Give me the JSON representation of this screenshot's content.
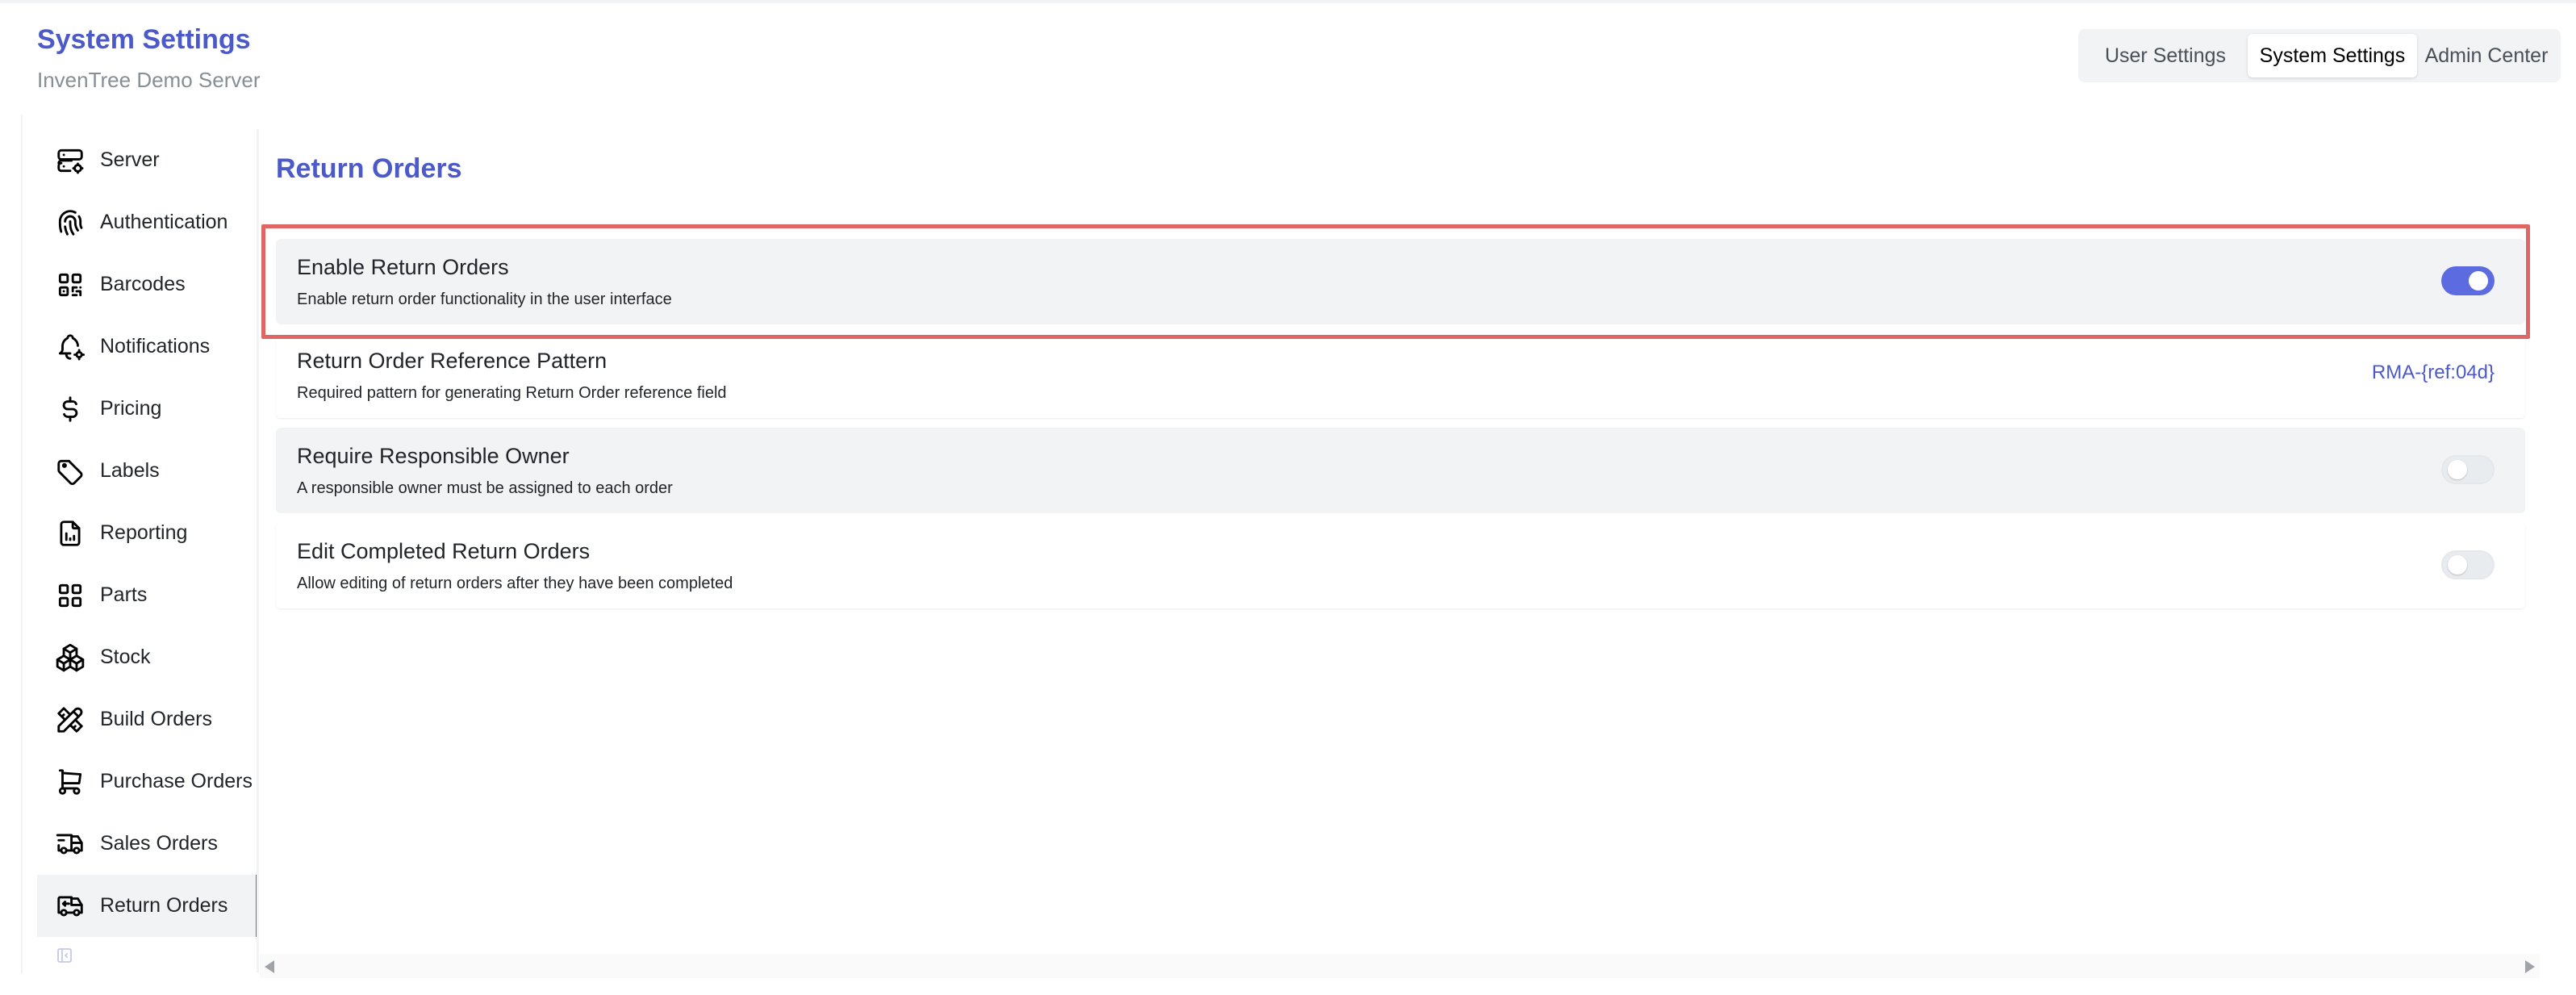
{
  "header": {
    "title": "System Settings",
    "subtitle": "InvenTree Demo Server",
    "segments": [
      {
        "label": "User Settings",
        "active": false
      },
      {
        "label": "System Settings",
        "active": true
      },
      {
        "label": "Admin Center",
        "active": false
      }
    ]
  },
  "sidebar": {
    "items": [
      {
        "label": "Server",
        "icon": "server-cog-icon"
      },
      {
        "label": "Authentication",
        "icon": "fingerprint-icon"
      },
      {
        "label": "Barcodes",
        "icon": "qrcode-icon"
      },
      {
        "label": "Notifications",
        "icon": "bell-cog-icon"
      },
      {
        "label": "Pricing",
        "icon": "dollar-icon"
      },
      {
        "label": "Labels",
        "icon": "tag-icon"
      },
      {
        "label": "Reporting",
        "icon": "report-icon"
      },
      {
        "label": "Parts",
        "icon": "grid-icon"
      },
      {
        "label": "Stock",
        "icon": "packages-icon"
      },
      {
        "label": "Build Orders",
        "icon": "tools-icon"
      },
      {
        "label": "Purchase Orders",
        "icon": "cart-icon"
      },
      {
        "label": "Sales Orders",
        "icon": "truck-delivery-icon"
      },
      {
        "label": "Return Orders",
        "icon": "truck-return-icon"
      }
    ],
    "active_index": 12
  },
  "main": {
    "section_title": "Return Orders",
    "settings": [
      {
        "name": "Enable Return Orders",
        "description": "Enable return order functionality in the user interface",
        "type": "toggle",
        "enabled": true
      },
      {
        "name": "Return Order Reference Pattern",
        "description": "Required pattern for generating Return Order reference field",
        "type": "text",
        "value": "RMA-{ref:04d}"
      },
      {
        "name": "Require Responsible Owner",
        "description": "A responsible owner must be assigned to each order",
        "type": "toggle",
        "enabled": false
      },
      {
        "name": "Edit Completed Return Orders",
        "description": "Allow editing of return orders after they have been completed",
        "type": "toggle",
        "enabled": false
      }
    ]
  },
  "colors": {
    "accent": "#5c6be0",
    "title": "#4c5ac9",
    "highlight": "#e06666"
  }
}
